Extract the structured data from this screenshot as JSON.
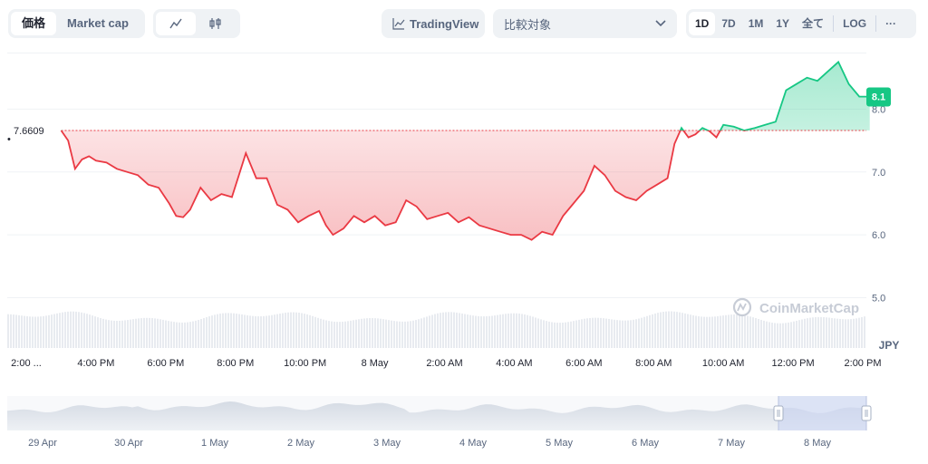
{
  "toolbar": {
    "metric_tabs": [
      "価格",
      "Market cap"
    ],
    "tradingview_label": "TradingView",
    "compare_placeholder": "比較対象",
    "ranges": [
      "1D",
      "7D",
      "1M",
      "1Y",
      "全て"
    ],
    "log_label": "LOG",
    "more_label": "···"
  },
  "watermark": "CoinMarketCap",
  "chart_data": {
    "type": "line",
    "currency_label": "JPY",
    "baseline_value": 7.6609,
    "baseline_label": "7.6609",
    "last_value_label": "8.1",
    "ylim": [
      4.2,
      8.9
    ],
    "y_ticks": [
      "5.0",
      "6.0",
      "7.0",
      "8.0"
    ],
    "y_tick_values": [
      5.0,
      6.0,
      7.0,
      8.0
    ],
    "x_tick_labels": [
      "2:00 ...",
      "4:00 PM",
      "6:00 PM",
      "8:00 PM",
      "10:00 PM",
      "8 May",
      "2:00 AM",
      "4:00 AM",
      "6:00 AM",
      "8:00 AM",
      "10:00 AM",
      "12:00 PM",
      "2:00 PM"
    ],
    "x_tick_hours": [
      2,
      4,
      6,
      8,
      10,
      12,
      14,
      16,
      18,
      20,
      22,
      24,
      26
    ],
    "series": [
      {
        "hours": [
          3.0,
          3.2,
          3.4,
          3.6,
          3.8,
          4.0,
          4.3,
          4.6,
          4.9,
          5.2,
          5.5,
          5.8,
          6.1,
          6.3,
          6.5,
          6.7,
          7.0,
          7.3,
          7.6,
          7.9,
          8.1,
          8.3,
          8.6,
          8.9,
          9.2,
          9.5,
          9.8,
          10.1,
          10.4,
          10.6,
          10.8,
          11.1,
          11.4,
          11.7,
          12.0,
          12.3,
          12.6,
          12.9,
          13.2,
          13.5,
          13.8,
          14.1,
          14.4,
          14.7,
          15.0,
          15.3,
          15.6,
          15.9,
          16.2,
          16.5,
          16.8,
          17.1,
          17.4,
          17.7,
          18.0,
          18.3,
          18.6,
          18.9,
          19.2,
          19.5,
          19.8,
          20.1,
          20.4,
          20.6,
          20.8,
          21.0,
          21.2,
          21.4,
          21.6,
          21.8,
          22.0,
          22.3,
          22.6,
          22.9,
          23.2,
          23.5,
          23.8,
          24.1,
          24.4,
          24.7,
          25.0,
          25.3,
          25.6,
          25.9,
          26.2
        ],
        "values": [
          7.66,
          7.5,
          7.05,
          7.2,
          7.25,
          7.18,
          7.15,
          7.05,
          7.0,
          6.95,
          6.8,
          6.75,
          6.5,
          6.3,
          6.28,
          6.4,
          6.75,
          6.55,
          6.65,
          6.6,
          6.95,
          7.3,
          6.9,
          6.9,
          6.48,
          6.4,
          6.2,
          6.3,
          6.38,
          6.15,
          6.0,
          6.1,
          6.3,
          6.2,
          6.3,
          6.15,
          6.2,
          6.55,
          6.45,
          6.25,
          6.3,
          6.35,
          6.2,
          6.28,
          6.15,
          6.1,
          6.05,
          6.0,
          6.0,
          5.92,
          6.05,
          6.0,
          6.3,
          6.5,
          6.7,
          7.1,
          6.95,
          6.7,
          6.6,
          6.55,
          6.7,
          6.8,
          6.9,
          7.45,
          7.7,
          7.55,
          7.6,
          7.7,
          7.65,
          7.55,
          7.75,
          7.72,
          7.66,
          7.7,
          7.75,
          7.8,
          8.3,
          8.4,
          8.5,
          8.45,
          8.6,
          8.75,
          8.4,
          8.2,
          8.2
        ]
      }
    ],
    "navigator_dates": [
      "29 Apr",
      "30 Apr",
      "1 May",
      "2 May",
      "3 May",
      "4 May",
      "5 May",
      "6 May",
      "7 May",
      "8 May"
    ],
    "colors": {
      "up": "#16c784",
      "down": "#ea3943"
    }
  }
}
